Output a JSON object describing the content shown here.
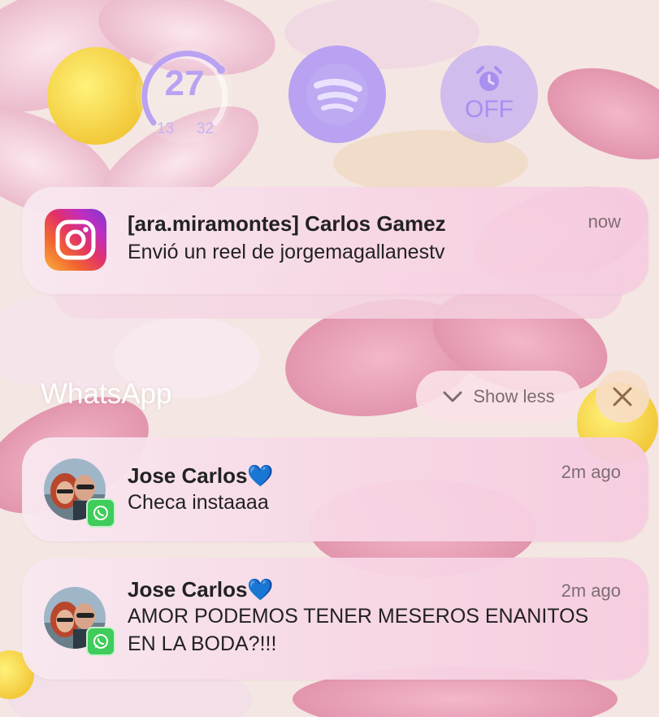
{
  "widgets": {
    "weather": {
      "temperature": "27",
      "low": "13",
      "high": "32"
    },
    "spotify": {
      "icon": "spotify-icon"
    },
    "alarm": {
      "label": "OFF",
      "icon": "alarm-clock-icon"
    }
  },
  "notifications": [
    {
      "app_icon": "instagram-icon",
      "title": "[ara.miramontes] Carlos Gamez",
      "body": "Envió un reel de jorgemagallanestv",
      "time": "now"
    }
  ],
  "group": {
    "app_name": "WhatsApp",
    "show_less_label": "Show less",
    "messages": [
      {
        "sender": "Jose Carlos💙",
        "body_lines": [
          "Checa instaaaa"
        ],
        "time": "2m ago"
      },
      {
        "sender": "Jose Carlos💙",
        "body_lines": [
          "AMOR PODEMOS TENER MESEROS ENANITOS",
          "EN LA BODA?!!!"
        ],
        "time": "2m ago"
      }
    ]
  },
  "colors": {
    "widget_purple": "#b9a2f2",
    "whatsapp_green": "#3fcc5a"
  }
}
